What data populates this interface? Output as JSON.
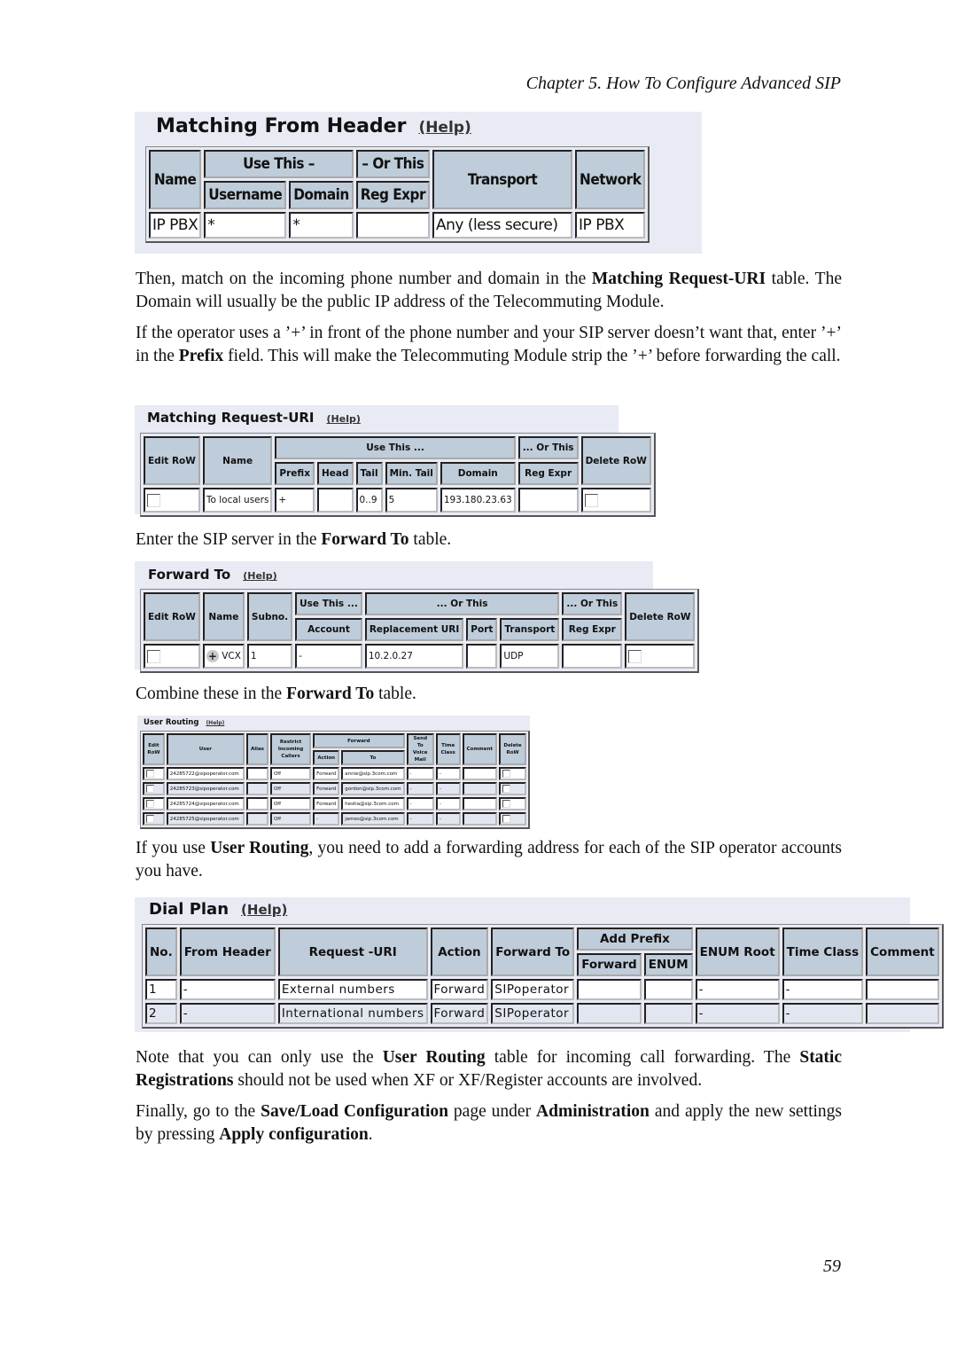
{
  "running_header": "Chapter 5. How To Configure Advanced SIP",
  "page_number": "59",
  "matching_from_header": {
    "title": "Matching From Header",
    "help": "(Help)",
    "headers": {
      "name": "Name",
      "use_this": "Use This –",
      "or_this": "– Or This",
      "transport": "Transport",
      "network": "Network",
      "username": "Username",
      "domain": "Domain",
      "reg_expr": "Reg Expr"
    },
    "rows": [
      {
        "name": "IP PBX",
        "username": "*",
        "domain": "*",
        "reg_expr": "",
        "transport": "Any (less secure)",
        "network": "IP PBX"
      }
    ]
  },
  "paragraphs": {
    "p1": {
      "a": "Then, match on the incoming phone number and domain in the ",
      "b": "Matching Request-URI",
      "c": " table. The Domain will usually be the public IP address of the Telecommuting Module."
    },
    "p2": {
      "a": "If the operator uses a ’+’ in front of the phone number and your SIP server doesn’t want that, enter ’+’ in the ",
      "b": "Prefix",
      "c": " field. This will make the Telecommuting Module strip the ’+’ before forwarding the call."
    },
    "p3": {
      "a": "Enter the SIP server in the ",
      "b": "Forward To",
      "c": " table."
    },
    "p4": {
      "a": "Combine these in the ",
      "b": "Forward To",
      "c": " table."
    },
    "p5": {
      "a": "If you use ",
      "b": "User Routing",
      "c": ", you need to add a forwarding address for each of the SIP operator accounts you have."
    },
    "p6": {
      "a": "Note that you can only use the ",
      "b": "User Routing",
      "c": " table for incoming call forwarding. The ",
      "d": "Static Registrations",
      "e": " should not be used when XF or XF/Register accounts are involved."
    },
    "p7": {
      "a": "Finally, go to the ",
      "b": "Save/Load Configuration",
      "c": " page under ",
      "d": "Administration",
      "e": " and apply the new settings by pressing ",
      "f": "Apply configuration",
      "g": "."
    }
  },
  "matching_request_uri": {
    "title": "Matching Request-URI",
    "help": "(Help)",
    "headers": {
      "edit_row": "Edit RoW",
      "name": "Name",
      "use_this": "Use This ...",
      "or_this": "... Or This",
      "delete_row": "Delete RoW",
      "prefix": "Prefix",
      "head": "Head",
      "tail": "Tail",
      "min_tail": "Min. Tail",
      "domain": "Domain",
      "reg_expr": "Reg Expr"
    },
    "rows": [
      {
        "name": "To local users",
        "prefix": "+",
        "head": "",
        "tail": "0..9",
        "min_tail": "5",
        "domain": "193.180.23.63",
        "reg_expr": ""
      }
    ]
  },
  "forward_to": {
    "title": "Forward To",
    "help": "(Help)",
    "headers": {
      "edit_row": "Edit RoW",
      "name": "Name",
      "subno": "Subno.",
      "use_this": "Use This ...",
      "or_this": "... Or This",
      "or_this2": "... Or This",
      "delete_row": "Delete RoW",
      "account": "Account",
      "replacement_uri": "Replacement URI",
      "port": "Port",
      "transport": "Transport",
      "reg_expr": "Reg Expr"
    },
    "rows": [
      {
        "plus": "+",
        "name": "VCX",
        "subno": "1",
        "account": "-",
        "replacement_uri": "10.2.0.27",
        "port": "",
        "transport": "UDP",
        "reg_expr": ""
      }
    ]
  },
  "user_routing": {
    "title": "User Routing",
    "help": "(Help)",
    "headers": {
      "edit_row": "Edit RoW",
      "user": "User",
      "alias": "Alias",
      "restrict": "Restrict Incoming Callers",
      "forward": "Forward",
      "action": "Action",
      "to": "To",
      "send_to_voicemail": "Send To Voice Mail",
      "time_class": "Time Class",
      "comment": "Comment",
      "delete_row": "Delete RoW"
    },
    "rows": [
      {
        "user": "24285722@sipoperator.com",
        "alias": "",
        "restrict": "Off",
        "action": "Forward",
        "to": "annie@sip.3com.com",
        "voicemail": "-",
        "time_class": "-",
        "comment": ""
      },
      {
        "user": "24285723@sipoperator.com",
        "alias": "",
        "restrict": "Off",
        "action": "Forward",
        "to": "gordon@sip.3com.com",
        "voicemail": "-",
        "time_class": "-",
        "comment": ""
      },
      {
        "user": "24285724@sipoperator.com",
        "alias": "",
        "restrict": "Off",
        "action": "Forward",
        "to": "hestia@sip.3com.com",
        "voicemail": "-",
        "time_class": "-",
        "comment": ""
      },
      {
        "user": "24285725@sipoperator.com",
        "alias": "",
        "restrict": "Off",
        "action": "-",
        "to": "james@sip.3com.com",
        "voicemail": "-",
        "time_class": "-",
        "comment": ""
      }
    ]
  },
  "dial_plan": {
    "title": "Dial Plan",
    "help": "(Help)",
    "headers": {
      "no": "No.",
      "from_header": "From Header",
      "request_uri": "Request -URI",
      "action": "Action",
      "forward_to": "Forward To",
      "add_prefix": "Add Prefix",
      "forward": "Forward",
      "enum": "ENUM",
      "enum_root": "ENUM Root",
      "time_class": "Time Class",
      "comment": "Comment"
    },
    "rows": [
      {
        "no": "1",
        "from_header": "-",
        "request_uri": "External numbers",
        "action": "Forward",
        "forward_to": "SIPoperator",
        "prefix_forward": "",
        "prefix_enum": "",
        "enum_root": "-",
        "time_class": "-",
        "comment": ""
      },
      {
        "no": "2",
        "from_header": "-",
        "request_uri": "International numbers",
        "action": "Forward",
        "forward_to": "SIPoperator",
        "prefix_forward": "",
        "prefix_enum": "",
        "enum_root": "-",
        "time_class": "-",
        "comment": ""
      }
    ]
  }
}
